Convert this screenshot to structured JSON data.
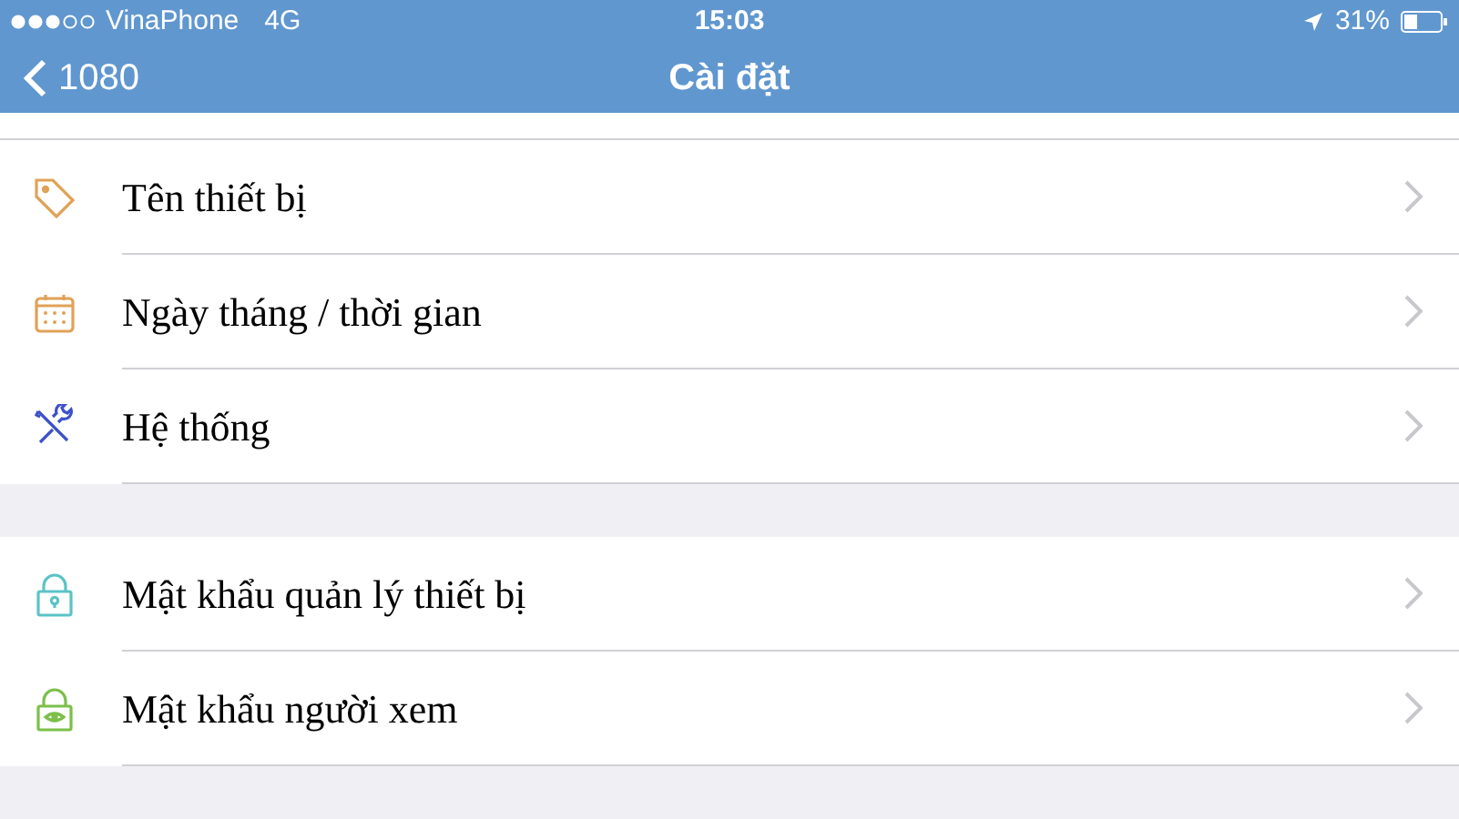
{
  "status_bar": {
    "carrier": "VinaPhone",
    "network": "4G",
    "time": "15:03",
    "battery": "31%"
  },
  "nav_bar": {
    "back_label": "1080",
    "title": "Cài đặt"
  },
  "sections": [
    {
      "items": [
        {
          "kind": "tag",
          "label": "Tên thiết bị",
          "color": "#e0a257"
        },
        {
          "kind": "calendar",
          "label": "Ngày tháng / thời gian",
          "color": "#e0a257"
        },
        {
          "kind": "tools",
          "label": "Hệ thống",
          "color": "#3d52c8"
        }
      ]
    },
    {
      "items": [
        {
          "kind": "lock-key",
          "label": "Mật khẩu quản lý thiết bị",
          "color": "#5cc3c5"
        },
        {
          "kind": "lock-eye",
          "label": "Mật khẩu người xem",
          "color": "#7cbf4a"
        }
      ]
    }
  ]
}
